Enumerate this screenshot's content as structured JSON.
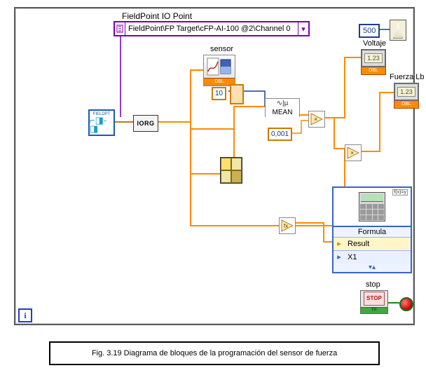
{
  "labels": {
    "iopoint_title": "FieldPoint IO Point",
    "iopath": "FieldPoint\\FP Target\\cFP-AI-100 @2\\Channel 0",
    "sensor": "sensor",
    "voltaje": "Voltaje",
    "fuerza": "Fuerza Lb",
    "formula_title": "Formula",
    "formula_result": "Result",
    "formula_x1": "X1",
    "stop": "stop",
    "stop_face": "STOP",
    "iter": "i"
  },
  "nodes": {
    "fieldpoint_type": "FIELDPT",
    "ioread": "IORG",
    "mean_top": "∿|µ",
    "mean_label": "MEAN",
    "dbl_tag": "DBL",
    "calc_tag": "f(x)=y",
    "tf_tag": "TF"
  },
  "constants": {
    "loop_ms": "500",
    "buffer_n": "10",
    "scale": "0,001"
  },
  "indicators": {
    "voltaje_sample": "1.23",
    "fuerza_sample": "1.23"
  },
  "caption": "Fig. 3.19 Diagrama de bloques de la programación del sensor de fuerza"
}
